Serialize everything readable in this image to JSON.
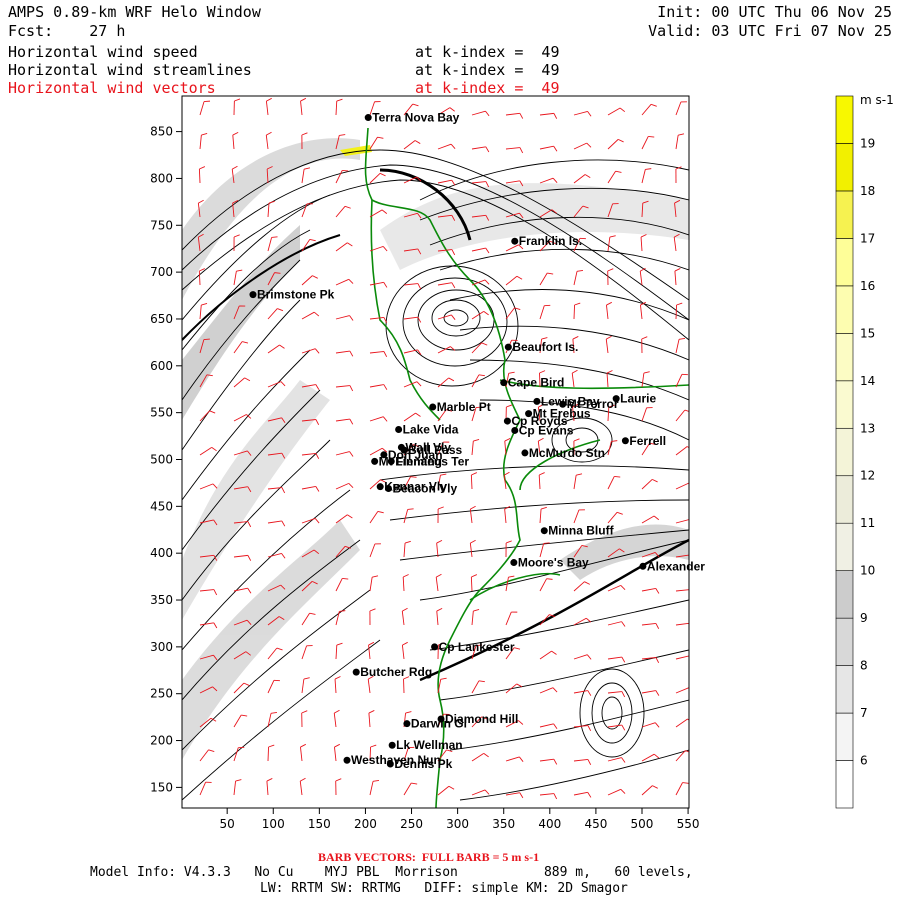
{
  "header": {
    "model_title": "AMPS 0.89-km WRF Helo Window",
    "forecast": "Fcst:    27 h",
    "init": "Init: 00 UTC Thu 06 Nov 25",
    "valid": "Valid: 03 UTC Fri 07 Nov 25",
    "fields": [
      {
        "name": "Horizontal wind speed",
        "level": "at k-index =  49",
        "color": "#000000"
      },
      {
        "name": "Horizontal wind streamlines",
        "level": "at k-index =  49",
        "color": "#000000"
      },
      {
        "name": "Horizontal wind vectors",
        "level": "at k-index =  49",
        "color": "#e8141c"
      }
    ]
  },
  "axes": {
    "x_ticks": [
      50,
      100,
      150,
      200,
      250,
      300,
      350,
      400,
      450,
      500,
      550
    ],
    "y_ticks": [
      150,
      200,
      250,
      300,
      350,
      400,
      450,
      500,
      550,
      600,
      650,
      700,
      750,
      800,
      850
    ],
    "x_range": [
      1,
      551
    ],
    "y_range": [
      128,
      888
    ]
  },
  "colorbar": {
    "unit": "m s-1",
    "levels": [
      6,
      7,
      8,
      9,
      10,
      11,
      12,
      13,
      14,
      15,
      16,
      17,
      18,
      19
    ],
    "colors": [
      "#ffffff",
      "#f4f4f4",
      "#e6e6e6",
      "#d8d8d8",
      "#cccccc",
      "#f0f0e4",
      "#ececda",
      "#f4f4d8",
      "#fafad0",
      "#fcfcc4",
      "#fdfdb0",
      "#fefe98",
      "#f6f250",
      "#f2f000",
      "#f8f800"
    ]
  },
  "stations": [
    {
      "name": "Terra Nova Bay",
      "x": 203,
      "y": 865
    },
    {
      "name": "Franklin Is.",
      "x": 362,
      "y": 733
    },
    {
      "name": "Brimstone Pk",
      "x": 78,
      "y": 676
    },
    {
      "name": "Beaufort Is.",
      "x": 355,
      "y": 620
    },
    {
      "name": "Cape Bird",
      "x": 350,
      "y": 582
    },
    {
      "name": "Lewis Bay",
      "x": 386,
      "y": 562
    },
    {
      "name": "Laurie",
      "x": 472,
      "y": 565
    },
    {
      "name": "Mt Terror",
      "x": 414,
      "y": 559
    },
    {
      "name": "Marble Pt",
      "x": 273,
      "y": 556
    },
    {
      "name": "Cp Royds",
      "x": 354,
      "y": 541
    },
    {
      "name": "Mt Erebus",
      "x": 377,
      "y": 549
    },
    {
      "name": "Lake Vida",
      "x": 236,
      "y": 532
    },
    {
      "name": "Cp Evans",
      "x": 362,
      "y": 531
    },
    {
      "name": "Ferrell",
      "x": 482,
      "y": 520
    },
    {
      "name": "Wall Vly",
      "x": 239,
      "y": 513
    },
    {
      "name": "Bull Pass",
      "x": 242,
      "y": 510
    },
    {
      "name": "McMurdo Stn",
      "x": 373,
      "y": 507
    },
    {
      "name": "Don Juan",
      "x": 220,
      "y": 505
    },
    {
      "name": "Mt Fleming",
      "x": 210,
      "y": 498
    },
    {
      "name": "Linnaeus Ter",
      "x": 228,
      "y": 498
    },
    {
      "name": "Kennar Vly",
      "x": 216,
      "y": 471
    },
    {
      "name": "Beacon Vly",
      "x": 225,
      "y": 469
    },
    {
      "name": "Minna Bluff",
      "x": 394,
      "y": 424
    },
    {
      "name": "Moore's Bay",
      "x": 361,
      "y": 390
    },
    {
      "name": "Alexander",
      "x": 501,
      "y": 386
    },
    {
      "name": "Cp Lankester",
      "x": 275,
      "y": 300
    },
    {
      "name": "Butcher Rdg",
      "x": 190,
      "y": 273
    },
    {
      "name": "Darwin Gl",
      "x": 245,
      "y": 218
    },
    {
      "name": "Diamond Hill",
      "x": 282,
      "y": 223
    },
    {
      "name": "Lk Wellman",
      "x": 229,
      "y": 195
    },
    {
      "name": "Westhaven Nun",
      "x": 180,
      "y": 179
    },
    {
      "name": "Dennis Pk",
      "x": 227,
      "y": 175
    }
  ],
  "footer": {
    "barb_note": "BARB VECTORS:  FULL BARB = 5 m s-1",
    "model_info": "Model Info: V4.3.3   No Cu    MYJ PBL  Morrison           889 m,   60 levels,",
    "physics": "LW: RRTM SW: RRTMG   DIFF: simple KM: 2D Smagor"
  }
}
